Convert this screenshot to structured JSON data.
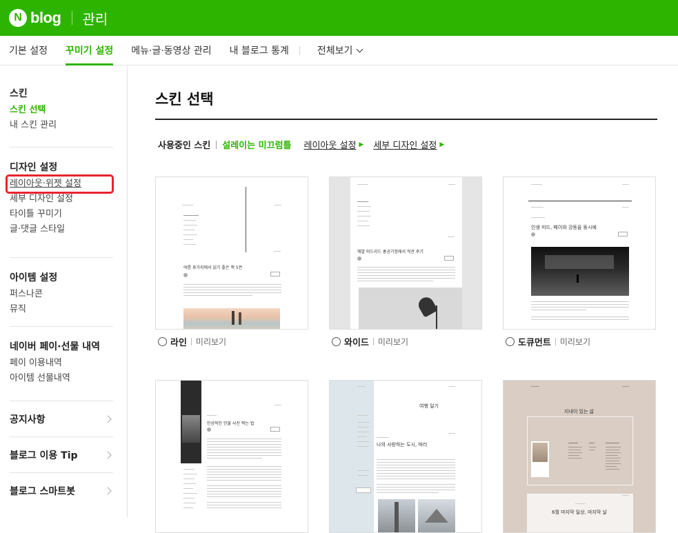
{
  "topbar": {
    "logo_mark": "N",
    "logo_text": "blog",
    "title": "관리"
  },
  "tabs": [
    {
      "label": "기본 설정",
      "active": false
    },
    {
      "label": "꾸미기 설정",
      "active": true
    },
    {
      "label": "메뉴·글·동영상 관리",
      "active": false
    },
    {
      "label": "내 블로그 통계",
      "active": false
    }
  ],
  "tabs_more": "전체보기",
  "sidebar": {
    "skin": {
      "title": "스킨",
      "items": [
        "스킨 선택",
        "내 스킨 관리"
      ]
    },
    "design": {
      "title": "디자인 설정",
      "items": [
        "레이아웃·위젯 설정",
        "세부 디자인 설정",
        "타이틀 꾸미기",
        "글·댓글 스타일"
      ]
    },
    "item": {
      "title": "아이템 설정",
      "items": [
        "퍼스나콘",
        "뮤직"
      ]
    },
    "pay": {
      "title": "네이버 페이·선물 내역",
      "items": [
        "페이 이용내역",
        "아이템 선물내역"
      ]
    },
    "links": [
      "공지사항",
      "블로그 이용 Tip",
      "블로그 스마트봇"
    ]
  },
  "main": {
    "title": "스킨 선택",
    "using_label": "사용중인 스킨",
    "current_skin": "설레이는 미끄럼틀",
    "link_layout": "레이아웃 설정",
    "link_detail": "세부 디자인 설정",
    "preview_label": "미리보기",
    "skins": [
      "라인",
      "와이드",
      "도큐먼트",
      "",
      "",
      ""
    ]
  },
  "thumbs": {
    "line_headline": "여름 휴가지에서 읽기 좋은 책 5권",
    "wide_headline": "해발 마드리드 홍공기정에서 직관 후기",
    "doc_headline": "인생 미드, 페이와 강동을 동시에",
    "dark_headline": "인상적인 인물 사진 찍는 법",
    "travel_title": "여행 일기",
    "travel_headline": "나의 사랑하는 도시, 파리",
    "beige_title": "지내이 있는 삶",
    "beige_headline": "6월 마지막 일상, 마지막 날"
  },
  "colors": {
    "brand": "#2db400",
    "highlight": "#e8232e"
  }
}
